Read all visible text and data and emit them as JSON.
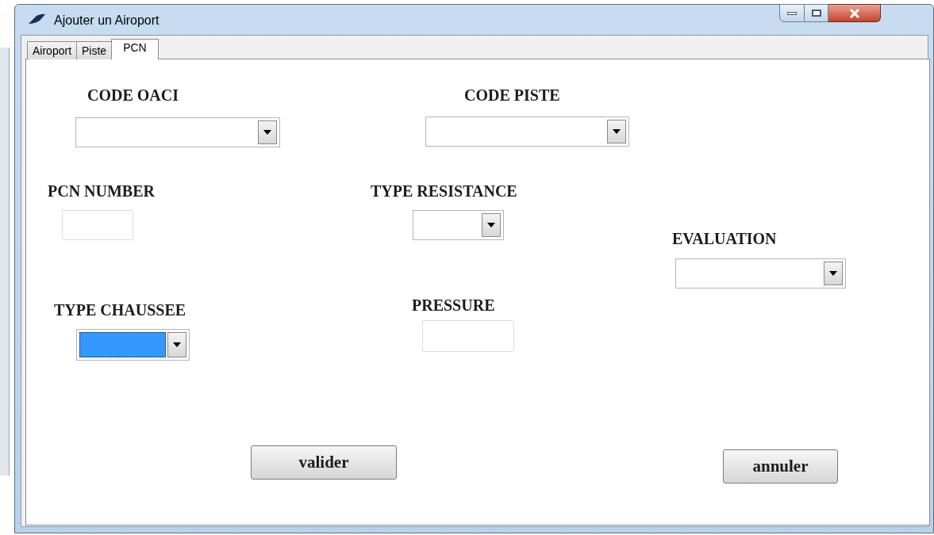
{
  "window": {
    "title": "Ajouter un Airoport"
  },
  "tabs": [
    {
      "label": "Airoport",
      "selected": false
    },
    {
      "label": "Piste",
      "selected": false
    },
    {
      "label": "PCN",
      "selected": true
    }
  ],
  "fields": [
    {
      "label": "CODE OACI",
      "kind": "combo",
      "focused": false
    },
    {
      "label": "CODE PISTE",
      "kind": "combo",
      "focused": false
    },
    {
      "label": "PCN NUMBER",
      "kind": "text",
      "focused": false
    },
    {
      "label": "TYPE RESISTANCE",
      "kind": "combo",
      "focused": false
    },
    {
      "label": "EVALUATION",
      "kind": "combo",
      "focused": false
    },
    {
      "label": "TYPE CHAUSSEE",
      "kind": "combo",
      "focused": true
    },
    {
      "label": "PRESSURE",
      "kind": "text",
      "focused": false
    }
  ],
  "buttons": [
    "valider",
    "annuler"
  ]
}
